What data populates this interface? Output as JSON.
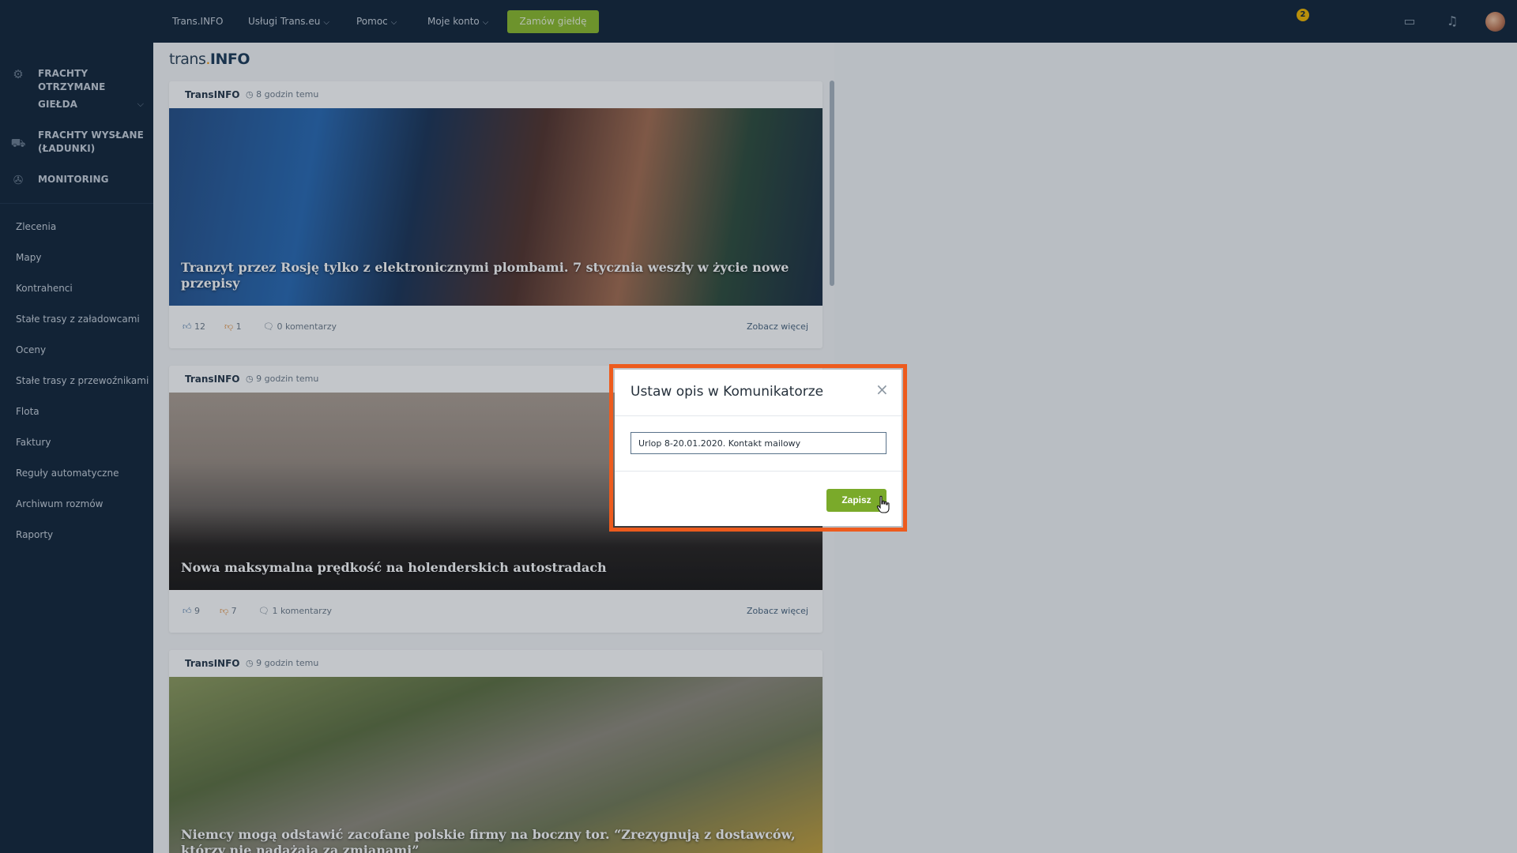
{
  "sidebar": {
    "main_items": [
      {
        "label": "FRACHTY OTRZYMANE",
        "icon": "hand-coins-icon"
      },
      {
        "label": "GIEŁDA",
        "icon": "",
        "has_chevron": true
      },
      {
        "label": "FRACHTY WYSŁANE (ŁADUNKI)",
        "icon": "truck-loading-icon"
      },
      {
        "label": "MONITORING",
        "icon": "satellite-icon"
      }
    ],
    "links": [
      "Zlecenia",
      "Mapy",
      "Kontrahenci",
      "Stałe trasy z załadowcami",
      "Oceny",
      "Stałe trasy z przewoźnikami",
      "Flota",
      "Faktury",
      "Reguły automatyczne",
      "Archiwum rozmów",
      "Raporty"
    ]
  },
  "topbar": {
    "nav": [
      {
        "label": "Trans.INFO",
        "has_chevron": false
      },
      {
        "label": "Usługi Trans.eu",
        "has_chevron": true
      },
      {
        "label": "Pomoc",
        "has_chevron": true
      },
      {
        "label": "Moje konto",
        "has_chevron": true
      }
    ],
    "order_button": "Zamów giełdę",
    "notification_count": "2",
    "icons": [
      "chat-icon",
      "bell-icon",
      "avatar"
    ]
  },
  "content": {
    "logo_prefix": "trans",
    "logo_dot": ".",
    "logo_suffix": "INFO",
    "articles": [
      {
        "source": "TransINFO",
        "time": "8 godzin temu",
        "title": "Tranzyt przez Rosję tylko z elektronicznymi plombami. 7 stycznia weszły w życie nowe przepisy",
        "likes": "12",
        "dislikes": "1",
        "comments": "0 komentarzy",
        "more": "Zobacz więcej"
      },
      {
        "source": "TransINFO",
        "time": "9 godzin temu",
        "title": "Nowa maksymalna prędkość na holenderskich autostradach",
        "likes": "9",
        "dislikes": "7",
        "comments": "1 komentarzy",
        "more": "Zobacz więcej"
      },
      {
        "source": "TransINFO",
        "time": "9 godzin temu",
        "title": "Niemcy mogą odstawić zacofane polskie firmy na boczny tor. “Zrezygnują z dostawców, którzy nie nadążają za zmianami”"
      }
    ]
  },
  "modal": {
    "title": "Ustaw opis w Komunikatorze",
    "close": "×",
    "input_value": "Urlop 8-20.01.2020. Kontakt mailowy",
    "save": "Zapisz",
    "highlight_color": "#ed5b1d"
  }
}
